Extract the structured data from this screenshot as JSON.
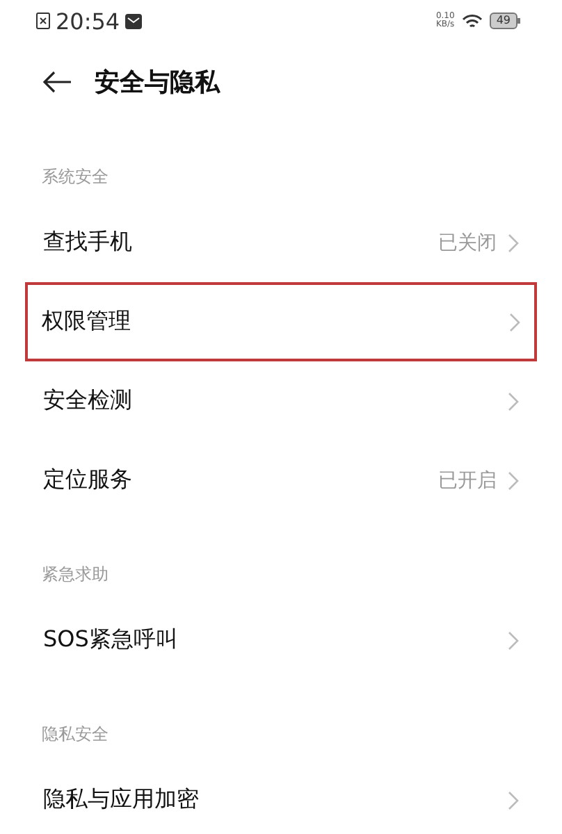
{
  "status_bar": {
    "time": "20:54",
    "network_speed": [
      "0.10",
      "KB/s"
    ],
    "battery": "49"
  },
  "header": {
    "title": "安全与隐私"
  },
  "sections": [
    {
      "title": "系统安全",
      "items": [
        {
          "label": "查找手机",
          "value": "已关闭",
          "highlighted": false
        },
        {
          "label": "权限管理",
          "highlighted": true
        },
        {
          "label": "安全检测",
          "highlighted": false
        },
        {
          "label": "定位服务",
          "value": "已开启",
          "highlighted": false
        }
      ]
    },
    {
      "title": "紧急求助",
      "items": [
        {
          "label": "SOS紧急呼叫",
          "highlighted": false
        }
      ]
    },
    {
      "title": "隐私安全",
      "items": [
        {
          "label": "隐私与应用加密",
          "highlighted": false
        }
      ]
    }
  ]
}
